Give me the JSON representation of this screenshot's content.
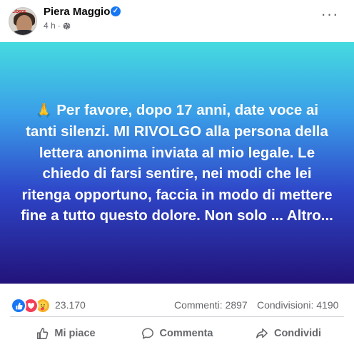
{
  "post": {
    "author": "Piera Maggio",
    "time": "4 h",
    "avatar_text": "Libera",
    "text": "Per favore, dopo 17 anni, date voce ai tanti silenzi. MI RIVOLGO alla persona della lettera anonima inviata al mio legale. Le chiedo di farsi sentire, nei modi che lei ritenga opportuno, faccia in modo di mettere fine a tutto questo dolore. Non solo ... Altro...",
    "pray_emoji": "🙏",
    "gradient_colors": [
      "#45dbe0",
      "#3a9ee8",
      "#2e46c8",
      "#22137a"
    ]
  },
  "stats": {
    "reactions_count": "23.170",
    "comments": "Commenti: 2897",
    "shares": "Condivisioni: 4190",
    "reaction_icons": [
      "like-icon",
      "love-icon",
      "care-icon"
    ]
  },
  "actions": {
    "like": "Mi piace",
    "comment": "Commenta",
    "share": "Condividi"
  },
  "colors": {
    "accent": "#1877f2",
    "secondary_text": "#65676b"
  }
}
